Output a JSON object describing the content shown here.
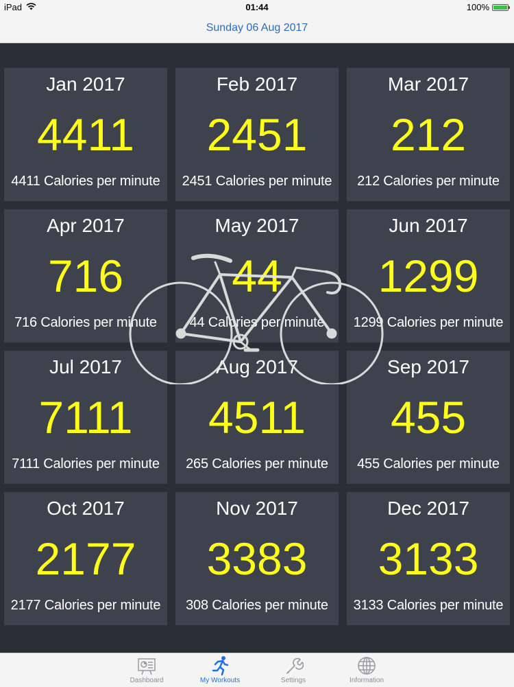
{
  "status_bar": {
    "device": "iPad",
    "time": "01:44",
    "battery": "100%",
    "battery_level": 1.0
  },
  "nav": {
    "title": "Sunday 06 Aug 2017"
  },
  "tiles": [
    {
      "month": "Jan 2017",
      "value": "4411",
      "caption": "4411 Calories per minute"
    },
    {
      "month": "Feb 2017",
      "value": "2451",
      "caption": "2451 Calories per minute"
    },
    {
      "month": "Mar 2017",
      "value": "212",
      "caption": "212 Calories per minute"
    },
    {
      "month": "Apr 2017",
      "value": "716",
      "caption": "716 Calories per minute"
    },
    {
      "month": "May 2017",
      "value": "44",
      "caption": "44 Calories per minute"
    },
    {
      "month": "Jun 2017",
      "value": "1299",
      "caption": "1299 Calories per minute"
    },
    {
      "month": "Jul 2017",
      "value": "7111",
      "caption": "7111 Calories per minute"
    },
    {
      "month": "Aug 2017",
      "value": "4511",
      "caption": "265 Calories per minute"
    },
    {
      "month": "Sep 2017",
      "value": "455",
      "caption": "455 Calories per minute"
    },
    {
      "month": "Oct 2017",
      "value": "2177",
      "caption": "2177 Calories per minute"
    },
    {
      "month": "Nov 2017",
      "value": "3383",
      "caption": "308 Calories per minute"
    },
    {
      "month": "Dec 2017",
      "value": "3133",
      "caption": "3133 Calories per minute"
    }
  ],
  "tabs": [
    {
      "label": "Dashboard",
      "icon": "dashboard-icon",
      "active": false
    },
    {
      "label": "My Workouts",
      "icon": "runner-icon",
      "active": true
    },
    {
      "label": "Settings",
      "icon": "wrench-icon",
      "active": false
    },
    {
      "label": "Information",
      "icon": "globe-icon",
      "active": false
    }
  ],
  "colors": {
    "accent": "#1f6fe0",
    "value_yellow": "#ffff1a",
    "tile_bg": "#3d424c",
    "page_bg": "#2a2e37",
    "battery_green": "#3ac04b"
  }
}
